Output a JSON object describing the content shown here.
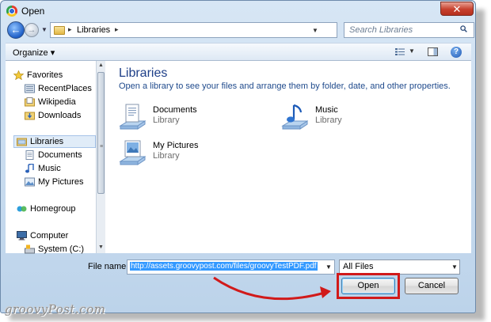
{
  "window": {
    "title": "Open",
    "close_glyph": "✕"
  },
  "nav": {
    "back_glyph": "←",
    "forward_glyph": "→",
    "address": {
      "crumb": "Libraries",
      "separator": "▸"
    },
    "refresh_glyph": "↻",
    "search": {
      "placeholder": "Search Libraries"
    }
  },
  "toolbar": {
    "organize_label": "Organize ▾",
    "help_glyph": "?"
  },
  "sidebar": {
    "favorites": {
      "label": "Favorites",
      "items": [
        "RecentPlaces",
        "Wikipedia",
        "Downloads"
      ]
    },
    "libraries": {
      "label": "Libraries",
      "items": [
        "Documents",
        "Music",
        "My Pictures"
      ]
    },
    "homegroup": {
      "label": "Homegroup"
    },
    "computer": {
      "label": "Computer",
      "items": [
        "System (C:)"
      ]
    }
  },
  "content": {
    "title": "Libraries",
    "description": "Open a library to see your files and arrange them by folder, date, and other properties.",
    "libraries": [
      {
        "name": "Documents",
        "type": "Library"
      },
      {
        "name": "Music",
        "type": "Library"
      },
      {
        "name": "My Pictures",
        "type": "Library"
      }
    ]
  },
  "footer": {
    "file_name_label": "File name:",
    "file_name_value": "http://assets.groovypost.com/files/groovyTestPDF.pdf",
    "file_type_value": "All Files",
    "open_label": "Open",
    "cancel_label": "Cancel"
  },
  "watermark": {
    "text": "groovyPost.com"
  },
  "colors": {
    "highlight": "#d11a1a",
    "selection": "#3399ff",
    "title_text": "#1e3f88"
  }
}
